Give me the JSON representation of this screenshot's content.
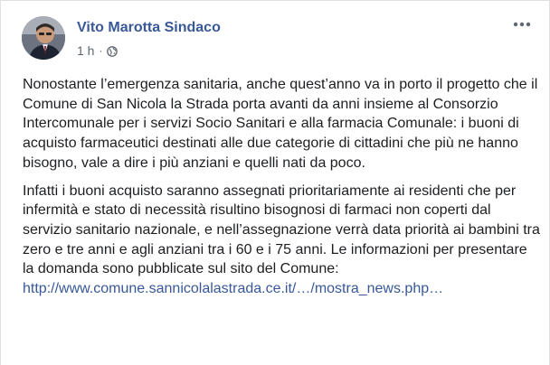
{
  "post": {
    "author": "Vito Marotta Sindaco",
    "time": "1 h",
    "separator": "·",
    "privacy_icon": "globe-icon",
    "menu_icon": "more-dots-icon",
    "paragraphs": [
      "Nonostante l’emergenza sanitaria, anche quest’anno va in porto il progetto che il Comune di San Nicola la Strada porta avanti da anni insieme al Consorzio Intercomunale per i servizi Socio Sanitari e alla farmacia Comunale: i buoni di acquisto farmaceutici destinati alle due categorie di cittadini che più ne hanno bisogno, vale a dire i più anziani e quelli nati da poco.",
      "Infatti i buoni acquisto saranno assegnati prioritariamente ai residenti che per infermità e stato di necessità risultino bisognosi di farmaci non coperti dal servizio sanitario nazionale, e nell’assegnazione verrà data priorità ai bambini tra zero e tre anni e agli anziani tra i 60 e i 75 anni. Le informazioni per presentare la domanda sono pubblicate sul sito del Comune:"
    ],
    "link_text": "http://www.comune.sannicolalastrada.ce.it/…/mostra_news.php…"
  },
  "colors": {
    "link": "#385898",
    "text": "#1c1e21",
    "meta": "#616770"
  }
}
